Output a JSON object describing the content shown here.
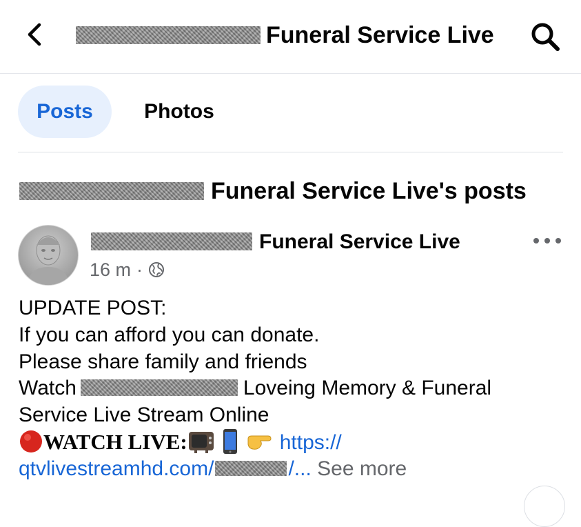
{
  "header": {
    "title": "Funeral Service Live",
    "back_icon": "chevron-left-icon",
    "search_icon": "search-icon"
  },
  "tabs": [
    {
      "label": "Posts",
      "active": true
    },
    {
      "label": "Photos",
      "active": false
    }
  ],
  "section": {
    "title": "Funeral Service Live's posts"
  },
  "post": {
    "author": "Funeral Service Live",
    "time": "16 m",
    "separator": "·",
    "audience_icon": "globe-icon",
    "more_icon": "more-horizontal-icon",
    "lines": {
      "l1": "UPDATE POST:",
      "l2": "If you can afford you can donate.",
      "l3": "Please share family and friends",
      "l4_prefix": "Watch",
      "l4_suffix": "Loveing Memory & Funeral",
      "l5": "Service Live Stream Online",
      "watch_live": "WATCH LIVE:",
      "link_start": "https://",
      "link_domain": "qtvlivestreamhd.com/",
      "link_end": "/...",
      "see_more": "See more"
    }
  },
  "colors": {
    "accent": "#1866d6",
    "active_tab_bg": "#e7f0fd",
    "secondary_text": "#65676b",
    "divider": "#dcdfe4"
  }
}
